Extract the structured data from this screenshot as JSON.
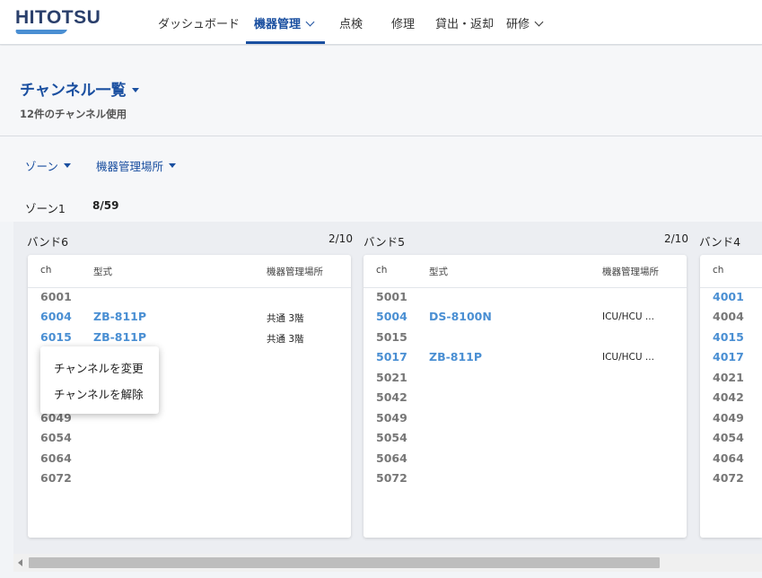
{
  "brand": {
    "logo_text": "HITOTSU",
    "accent": "#1a4fa0",
    "link": "#4a8fd3"
  },
  "nav": {
    "dashboard": "ダッシュボード",
    "equipment": "機器管理",
    "inspection": "点検",
    "repair": "修理",
    "lending": "貸出・返却",
    "training": "研修"
  },
  "page": {
    "title": "チャンネル一覧",
    "subtitle": "12件のチャンネル使用"
  },
  "filters": {
    "zone": "ゾーン",
    "location": "機器管理場所"
  },
  "zone": {
    "label": "ゾーン1",
    "count": "8/59"
  },
  "table_headers": {
    "ch": "ch",
    "model": "型式",
    "location": "機器管理場所"
  },
  "bands": [
    {
      "title": "バンド6",
      "count": "2/10",
      "rows": [
        {
          "ch": "6001",
          "model": "",
          "location": "",
          "used": false
        },
        {
          "ch": "6004",
          "model": "ZB-811P",
          "location": "共通 3階",
          "used": true
        },
        {
          "ch": "6015",
          "model": "ZB-811P",
          "location": "共通 3階",
          "used": true
        },
        {
          "ch": "6049",
          "model": "",
          "location": "",
          "used": false
        },
        {
          "ch": "6054",
          "model": "",
          "location": "",
          "used": false
        },
        {
          "ch": "6064",
          "model": "",
          "location": "",
          "used": false
        },
        {
          "ch": "6072",
          "model": "",
          "location": "",
          "used": false
        }
      ]
    },
    {
      "title": "バンド5",
      "count": "2/10",
      "rows": [
        {
          "ch": "5001",
          "model": "",
          "location": "",
          "used": false
        },
        {
          "ch": "5004",
          "model": "DS-8100N",
          "location": "ICU/HCU ...",
          "used": true
        },
        {
          "ch": "5015",
          "model": "",
          "location": "",
          "used": false
        },
        {
          "ch": "5017",
          "model": "ZB-811P",
          "location": "ICU/HCU ...",
          "used": true
        },
        {
          "ch": "5021",
          "model": "",
          "location": "",
          "used": false
        },
        {
          "ch": "5042",
          "model": "",
          "location": "",
          "used": false
        },
        {
          "ch": "5049",
          "model": "",
          "location": "",
          "used": false
        },
        {
          "ch": "5054",
          "model": "",
          "location": "",
          "used": false
        },
        {
          "ch": "5064",
          "model": "",
          "location": "",
          "used": false
        },
        {
          "ch": "5072",
          "model": "",
          "location": "",
          "used": false
        }
      ]
    },
    {
      "title": "バンド4",
      "count": "",
      "rows": [
        {
          "ch": "4001",
          "model": "",
          "location": "",
          "used": true
        },
        {
          "ch": "4004",
          "model": "",
          "location": "",
          "used": false
        },
        {
          "ch": "4015",
          "model": "",
          "location": "",
          "used": true
        },
        {
          "ch": "4017",
          "model": "",
          "location": "",
          "used": true
        },
        {
          "ch": "4021",
          "model": "",
          "location": "",
          "used": false
        },
        {
          "ch": "4042",
          "model": "",
          "location": "",
          "used": false
        },
        {
          "ch": "4049",
          "model": "",
          "location": "",
          "used": false
        },
        {
          "ch": "4054",
          "model": "",
          "location": "",
          "used": false
        },
        {
          "ch": "4064",
          "model": "",
          "location": "",
          "used": false
        },
        {
          "ch": "4072",
          "model": "",
          "location": "",
          "used": false
        }
      ]
    }
  ],
  "context_menu": {
    "change": "チャンネルを変更",
    "release": "チャンネルを解除"
  }
}
